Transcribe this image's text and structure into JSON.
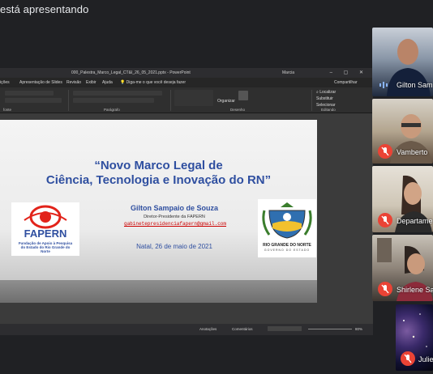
{
  "banner": {
    "text": "está apresentando"
  },
  "ppt": {
    "title_bar": "000_Palestra_Marco_Legal_CT&I_26_05_2021.pptx - PowerPoint",
    "account": "Marcia",
    "window_controls": "–  ▢  ✕",
    "tabs": [
      "ições",
      "Apresentação de Slides",
      "Revisão",
      "Exibir",
      "Ajuda",
      "Diga-me o que você deseja fazer"
    ],
    "share_label": "Compartilhar",
    "ribbon_groups": [
      "fonte",
      "Parágrafo",
      "Desenho",
      "Editando"
    ],
    "ribbon_buttons": {
      "organize": "Organizar",
      "find": "Localizar",
      "replace": "Substituir",
      "select": "Selecionar"
    },
    "status": {
      "notes": "Anotações",
      "comments": "Comentários",
      "zoom": "80%"
    }
  },
  "slide": {
    "title_line1": "“Novo Marco Legal de",
    "title_line2": "Ciência, Tecnologia e Inovação do RN”",
    "speaker_name": "Gilton Sampaio de Souza",
    "speaker_role": "Diretor-Presidente da FAPERN",
    "speaker_email": "gabinetepresidenciafapern@gmail.com",
    "date": "Natal, 26 de maio de 2021",
    "fapern_logo_text": "FAPERN",
    "fapern_subtitle": "Fundação de Apoio à Pesquisa do Estado do Rio Grande do Norte",
    "rn_logo_text": "RIO GRANDE DO NORTE",
    "rn_logo_sub": "GOVERNO DO ESTADO"
  },
  "participants": [
    {
      "name": "Gilton Sam",
      "muted": false
    },
    {
      "name": "Vamberto",
      "muted": true
    },
    {
      "name": "Departame",
      "muted": true
    },
    {
      "name": "Shirlene Sa",
      "muted": true
    },
    {
      "name": "Julie",
      "muted": true
    }
  ],
  "colors": {
    "accent_blue": "#2f4fa0",
    "mute_red": "#ea4335",
    "meet_bg": "#202124"
  }
}
